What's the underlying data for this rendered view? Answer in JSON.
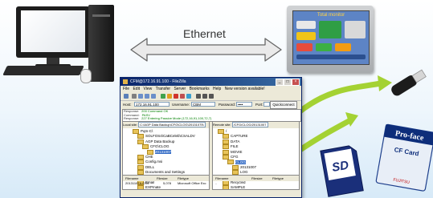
{
  "network_label": "Ethernet",
  "hmi": {
    "screen_title": "Total monitor"
  },
  "window": {
    "title": "CFM@172.16.91.100 - FileZilla",
    "controls": {
      "minimize": "_",
      "maximize": "□",
      "close": "×"
    },
    "menu": [
      "File",
      "Edit",
      "View",
      "Transfer",
      "Server",
      "Bookmarks",
      "Help",
      "New version available!"
    ],
    "quickconnect": {
      "host_label": "Host:",
      "host_value": "172.16.91.100",
      "username_label": "Username:",
      "username_value": "CBM",
      "password_label": "Password:",
      "password_value": "••••",
      "port_label": "Port:",
      "port_value": "",
      "button": "Quickconnect ▼"
    },
    "log": [
      {
        "label": "Response:",
        "message": "200 Command OK"
      },
      {
        "label": "Command:",
        "message": "PASV"
      },
      {
        "label": "Response:",
        "message": "227 Entering Passive Mode (172,16,91,100,72,7)"
      }
    ],
    "local": {
      "site_label": "Local site:",
      "site_value": "C:\\AGP Data Backup\\CFG\\CLOG\\20131075\\",
      "tree": [
        {
          "label": "Pqm-C\\",
          "level": 2
        },
        {
          "label": "SOLFOS4\\CaBCeleb\\CSALDV",
          "level": 3
        },
        {
          "label": "AGP Data Backup",
          "level": 3
        },
        {
          "label": "CFG\\CLOG",
          "level": 4
        },
        {
          "label": "20131007",
          "level": 5,
          "selected": true
        },
        {
          "label": "CHE",
          "level": 3
        },
        {
          "label": "Config.msi",
          "level": 3
        },
        {
          "label": "DELL",
          "level": 3
        },
        {
          "label": "Documents and Settings",
          "level": 3
        },
        {
          "label": "Downloads",
          "level": 3
        },
        {
          "label": "Email",
          "level": 3
        },
        {
          "label": "EXPmate",
          "level": 3
        },
        {
          "label": "EXT",
          "level": 3
        }
      ],
      "columns": [
        "Filename",
        "Filesize",
        "Filetype"
      ],
      "rows": [
        {
          "name": "20131107A.CSV",
          "size": "5,078",
          "type": "Microsoft Office Exc"
        }
      ]
    },
    "remote": {
      "site_label": "Remote site:",
      "site_value": "/CFG/CLOG/20131007",
      "tree": [
        {
          "label": "/",
          "level": 1
        },
        {
          "label": "CAPTURE",
          "level": 2
        },
        {
          "label": "DATA",
          "level": 2
        },
        {
          "label": "FILE",
          "level": 2
        },
        {
          "label": "MOVIE",
          "level": 2
        },
        {
          "label": "CFG",
          "level": 2
        },
        {
          "label": "CLOG",
          "level": 3,
          "selected": true
        },
        {
          "label": "20131007",
          "level": 4
        },
        {
          "label": "LOG",
          "level": 4
        },
        {
          "label": "PLOG",
          "level": 2
        },
        {
          "label": "Recycled",
          "level": 2
        },
        {
          "label": "SAMPLE",
          "level": 2
        },
        {
          "label": "SMPM",
          "level": 2
        },
        {
          "label": "WBSDB",
          "level": 2
        }
      ],
      "columns": [
        "Filename",
        "Filesize",
        "Filetype"
      ],
      "rows": [
        {
          "name": "..",
          "size": "",
          "type": ""
        }
      ]
    }
  },
  "cards": {
    "sd_label": "SD",
    "cf_brand": "Pro-face",
    "cf_label": "CF Card",
    "cf_maker": "FUJITSU"
  }
}
